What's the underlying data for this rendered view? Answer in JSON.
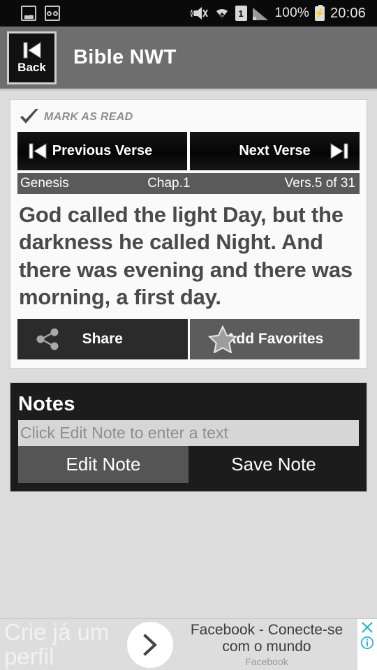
{
  "status_bar": {
    "left_icons": [
      "gallery-icon",
      "voicemail-icon"
    ],
    "right_icons": [
      "vibrate-mute-icon",
      "wifi-icon",
      "sim-1-icon",
      "signal-icon",
      "battery-charging-icon"
    ],
    "sim_label": "1",
    "battery_percent": "100%",
    "time": "20:06"
  },
  "header": {
    "back_label": "Back",
    "back_icon": "skip-previous-icon",
    "title": "Bible NWT"
  },
  "verse_card": {
    "mark_as_read_label": "MARK AS READ",
    "mark_as_read_icon": "check-icon",
    "nav": {
      "previous_label": "Previous Verse",
      "previous_icon": "skip-previous-icon",
      "next_label": "Next Verse",
      "next_icon": "skip-next-icon"
    },
    "reference": {
      "book": "Genesis",
      "chapter": "Chap.1",
      "verse": "Vers.5 of 31"
    },
    "verse_text": "God called the light Day, but the darkness he called Night. And there was evening and there was morning, a first day.",
    "actions": {
      "share_label": "Share",
      "share_icon": "share-icon",
      "favorites_label": "Add Favorites",
      "favorites_icon": "star-icon"
    }
  },
  "notes": {
    "title": "Notes",
    "input_value": "",
    "input_placeholder": "Click Edit Note to enter a text",
    "edit_label": "Edit Note",
    "save_label": "Save Note"
  },
  "ad": {
    "left_text": "Crie já um perfil",
    "arrow_icon": "chevron-right-icon",
    "headline": "Facebook - Conecte-se com o mundo",
    "advertiser": "Facebook",
    "close_icon": "close-icon",
    "info_icon": "info-icon"
  },
  "colors": {
    "page_background": "#dcdcdc",
    "header_background": "#6e6e6e",
    "card_background": "#fafafa",
    "dark_button": "#0a0a0a",
    "reference_bar": "#5a5a5a",
    "verse_text": "#4a4a4a",
    "notes_panel": "#1c1c1c",
    "ad_accent": "#2ab5d0"
  }
}
